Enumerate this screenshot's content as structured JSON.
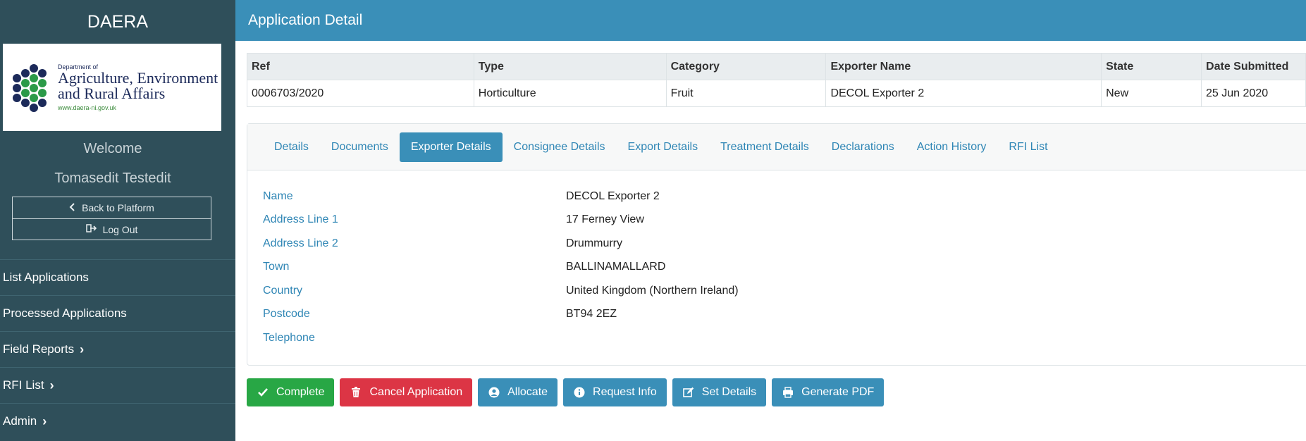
{
  "sidebar": {
    "brand": "DAERA",
    "logo": {
      "small_text": "Department of",
      "line1": "Agriculture, Environment",
      "line2": "and Rural Affairs",
      "url": "www.daera-ni.gov.uk"
    },
    "welcome": "Welcome",
    "user_name": "Tomasedit Testedit",
    "back_label": "Back to Platform",
    "logout_label": "Log Out",
    "nav": [
      {
        "label": "List Applications"
      },
      {
        "label": "Processed Applications"
      },
      {
        "label": "Field Reports"
      },
      {
        "label": "RFI List"
      },
      {
        "label": "Admin"
      }
    ]
  },
  "header": {
    "title": "Application Detail"
  },
  "summary": {
    "headers": [
      "Ref",
      "Type",
      "Category",
      "Exporter Name",
      "State",
      "Date Submitted"
    ],
    "row": [
      "0006703/2020",
      "Horticulture",
      "Fruit",
      "DECOL Exporter 2",
      "New",
      "25 Jun 2020"
    ]
  },
  "tabs": [
    {
      "label": "Details"
    },
    {
      "label": "Documents"
    },
    {
      "label": "Exporter Details"
    },
    {
      "label": "Consignee Details"
    },
    {
      "label": "Export Details"
    },
    {
      "label": "Treatment Details"
    },
    {
      "label": "Declarations"
    },
    {
      "label": "Action History"
    },
    {
      "label": "RFI List"
    }
  ],
  "active_tab": "Exporter Details",
  "exporter": [
    {
      "label": "Name",
      "value": "DECOL Exporter 2"
    },
    {
      "label": "Address Line 1",
      "value": "17 Ferney View"
    },
    {
      "label": "Address Line 2",
      "value": "Drummurry"
    },
    {
      "label": "Town",
      "value": "BALLINAMALLARD"
    },
    {
      "label": "Country",
      "value": "United Kingdom (Northern Ireland)"
    },
    {
      "label": "Postcode",
      "value": "BT94 2EZ"
    },
    {
      "label": "Telephone",
      "value": ""
    }
  ],
  "actions": {
    "complete": "Complete",
    "cancel": "Cancel Application",
    "allocate": "Allocate",
    "request_info": "Request Info",
    "set_details": "Set Details",
    "generate_pdf": "Generate PDF"
  },
  "colors": {
    "sidebar": "#2f4f5a",
    "header": "#3a8fb8",
    "link": "#2f86b5",
    "success": "#28a745",
    "danger": "#dc3545"
  }
}
